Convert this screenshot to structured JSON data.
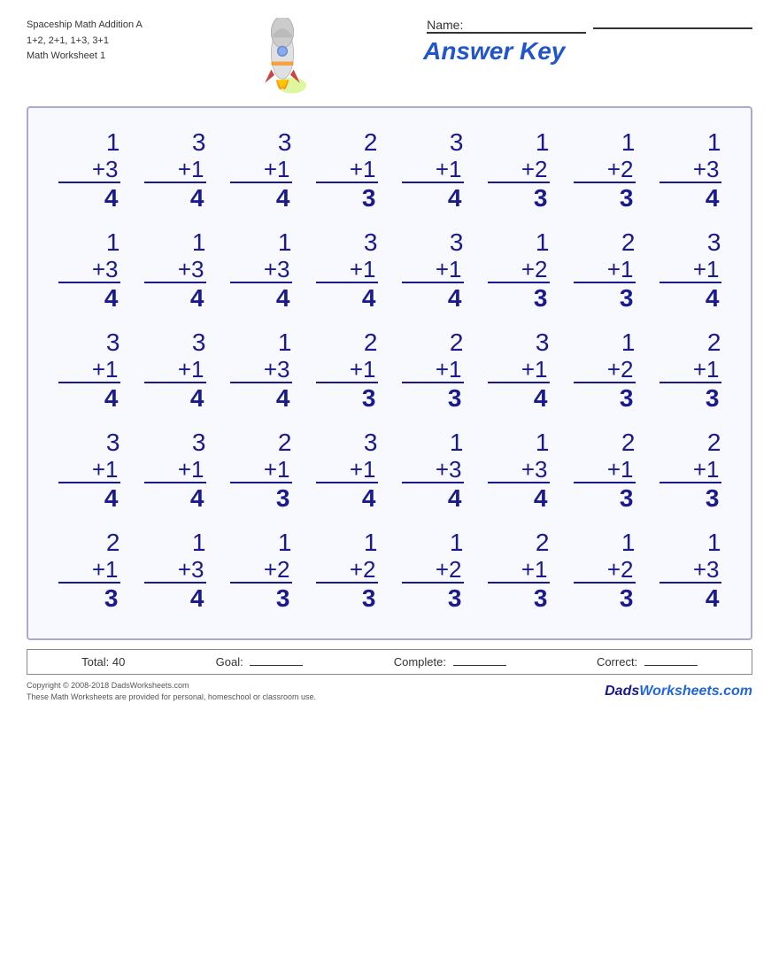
{
  "header": {
    "line1": "Spaceship Math Addition A",
    "line2": "1+2, 2+1, 1+3, 3+1",
    "line3": "Math Worksheet 1",
    "name_label": "Name:",
    "answer_key": "Answer Key"
  },
  "rows": [
    [
      {
        "top": "1",
        "add": "+3",
        "ans": "4"
      },
      {
        "top": "3",
        "add": "+1",
        "ans": "4"
      },
      {
        "top": "3",
        "add": "+1",
        "ans": "4"
      },
      {
        "top": "2",
        "add": "+1",
        "ans": "3"
      },
      {
        "top": "3",
        "add": "+1",
        "ans": "4"
      },
      {
        "top": "1",
        "add": "+2",
        "ans": "3"
      },
      {
        "top": "1",
        "add": "+2",
        "ans": "3"
      },
      {
        "top": "1",
        "add": "+3",
        "ans": "4"
      }
    ],
    [
      {
        "top": "1",
        "add": "+3",
        "ans": "4"
      },
      {
        "top": "1",
        "add": "+3",
        "ans": "4"
      },
      {
        "top": "1",
        "add": "+3",
        "ans": "4"
      },
      {
        "top": "3",
        "add": "+1",
        "ans": "4"
      },
      {
        "top": "3",
        "add": "+1",
        "ans": "4"
      },
      {
        "top": "1",
        "add": "+2",
        "ans": "3"
      },
      {
        "top": "2",
        "add": "+1",
        "ans": "3"
      },
      {
        "top": "3",
        "add": "+1",
        "ans": "4"
      }
    ],
    [
      {
        "top": "3",
        "add": "+1",
        "ans": "4"
      },
      {
        "top": "3",
        "add": "+1",
        "ans": "4"
      },
      {
        "top": "1",
        "add": "+3",
        "ans": "4"
      },
      {
        "top": "2",
        "add": "+1",
        "ans": "3"
      },
      {
        "top": "2",
        "add": "+1",
        "ans": "3"
      },
      {
        "top": "3",
        "add": "+1",
        "ans": "4"
      },
      {
        "top": "1",
        "add": "+2",
        "ans": "3"
      },
      {
        "top": "2",
        "add": "+1",
        "ans": "3"
      }
    ],
    [
      {
        "top": "3",
        "add": "+1",
        "ans": "4"
      },
      {
        "top": "3",
        "add": "+1",
        "ans": "4"
      },
      {
        "top": "2",
        "add": "+1",
        "ans": "3"
      },
      {
        "top": "3",
        "add": "+1",
        "ans": "4"
      },
      {
        "top": "1",
        "add": "+3",
        "ans": "4"
      },
      {
        "top": "1",
        "add": "+3",
        "ans": "4"
      },
      {
        "top": "2",
        "add": "+1",
        "ans": "3"
      },
      {
        "top": "2",
        "add": "+1",
        "ans": "3"
      }
    ],
    [
      {
        "top": "2",
        "add": "+1",
        "ans": "3"
      },
      {
        "top": "1",
        "add": "+3",
        "ans": "4"
      },
      {
        "top": "1",
        "add": "+2",
        "ans": "3"
      },
      {
        "top": "1",
        "add": "+2",
        "ans": "3"
      },
      {
        "top": "1",
        "add": "+2",
        "ans": "3"
      },
      {
        "top": "2",
        "add": "+1",
        "ans": "3"
      },
      {
        "top": "1",
        "add": "+2",
        "ans": "3"
      },
      {
        "top": "1",
        "add": "+3",
        "ans": "4"
      }
    ]
  ],
  "totals": {
    "total_label": "Total: 40",
    "goal_label": "Goal:",
    "complete_label": "Complete:",
    "correct_label": "Correct:"
  },
  "footer": {
    "copyright": "Copyright © 2008-2018 DadsWorksheets.com",
    "usage": "These Math Worksheets are provided for personal, homeschool or classroom use.",
    "brand": "DadsWorksheets.com"
  }
}
